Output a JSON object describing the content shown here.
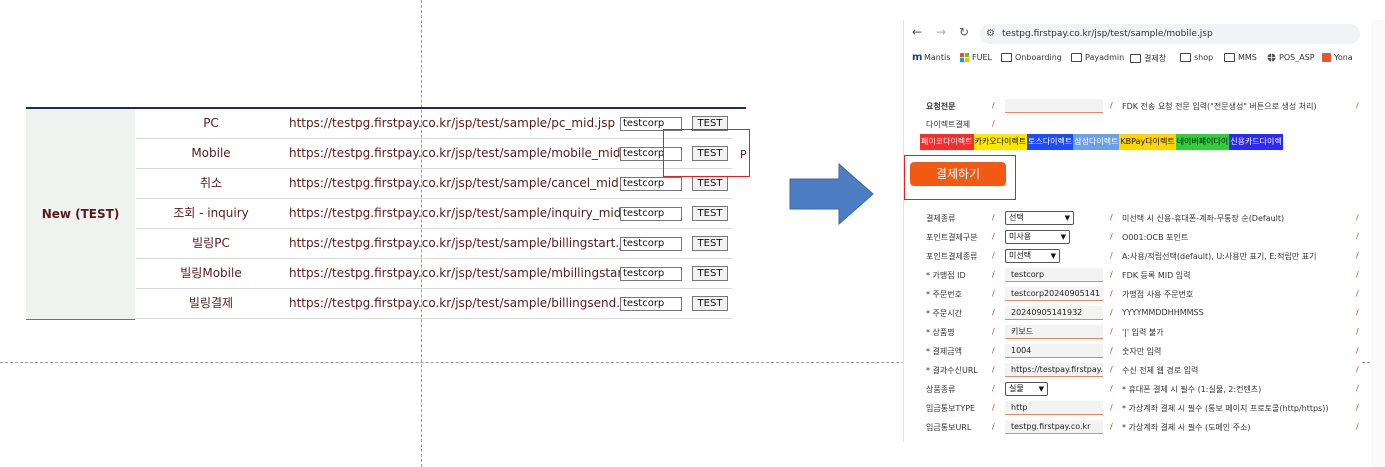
{
  "left_table": {
    "category": "New (TEST)",
    "rows": [
      {
        "name": "PC",
        "url": "https://testpg.firstpay.co.kr/jsp/test/sample/pc_mid.jsp",
        "input": "testcorp",
        "button": "TEST"
      },
      {
        "name": "Mobile",
        "url": "https://testpg.firstpay.co.kr/jsp/test/sample/mobile_mid.jsp",
        "input": "testcorp",
        "button": "TEST"
      },
      {
        "name": "취소",
        "url": "https://testpg.firstpay.co.kr/jsp/test/sample/cancel_mid.jsp",
        "input": "testcorp",
        "button": "TEST"
      },
      {
        "name": "조회 - inquiry",
        "url": "https://testpg.firstpay.co.kr/jsp/test/sample/inquiry_mid.jsp",
        "input": "testcorp",
        "button": "TEST"
      },
      {
        "name": "빌링PC",
        "url": "https://testpg.firstpay.co.kr/jsp/test/sample/billingstart.jsp",
        "input": "testcorp",
        "button": "TEST"
      },
      {
        "name": "빌링Mobile",
        "url": "https://testpg.firstpay.co.kr/jsp/test/sample/mbillingstart.jsp",
        "input": "testcorp",
        "button": "TEST"
      },
      {
        "name": "빌링결제",
        "url": "https://testpg.firstpay.co.kr/jsp/test/sample/billingsend.jsp",
        "input": "testcorp",
        "button": "TEST"
      }
    ],
    "trailing_char": "P"
  },
  "browser": {
    "url": "testpg.firstpay.co.kr/jsp/test/sample/mobile.jsp",
    "bookmarks": [
      {
        "label": "Mantis",
        "icon": "mantis-icon"
      },
      {
        "label": "FUEL",
        "icon": "windows-icon"
      },
      {
        "label": "Onboarding",
        "icon": "folder-icon"
      },
      {
        "label": "Payadmin",
        "icon": "folder-icon"
      },
      {
        "label": "결제창",
        "icon": "folder-icon"
      },
      {
        "label": "shop",
        "icon": "folder-icon"
      },
      {
        "label": "MMS",
        "icon": "folder-icon"
      },
      {
        "label": "POS_ASP",
        "icon": "globe-icon"
      },
      {
        "label": "Yona",
        "icon": "yona-icon"
      }
    ]
  },
  "form": {
    "request_label": "요청전문",
    "request_desc": "FDK 전송 요청 전문 입력(\"전문생성\" 버튼으로 생성 처리)",
    "direct_label": "다이렉트결제",
    "direct_buttons": [
      {
        "label": "페이코다이렉트",
        "color": "#ff2a2a"
      },
      {
        "label": "카카오다이렉트",
        "color": "#ffe600"
      },
      {
        "label": "토스다이렉트",
        "color": "#1e4bff"
      },
      {
        "label": "삼성다이렉트",
        "color": "#6aa0ea"
      },
      {
        "label": "KBPay다이렉트",
        "color": "#ffd400"
      },
      {
        "label": "네이버페이다이",
        "color": "#2fcf3a"
      },
      {
        "label": "신용카드다이렉",
        "color": "#2a2aff"
      }
    ],
    "pay_button": "결제하기",
    "fields": [
      {
        "label": "결제종류",
        "kind": "select",
        "value": "선택",
        "desc": "미선택 시 신용-휴대폰-계좌-무통장 순(Default)"
      },
      {
        "label": "포인트결제구분",
        "kind": "select",
        "value": "미사용",
        "desc": "O001:OCB 포인트"
      },
      {
        "label": "포인트결제종류",
        "kind": "select",
        "value": "미선택",
        "desc": "A:사용/적립선택(default), U:사용만 표기, E:적립만 표기"
      },
      {
        "label": "* 가맹점 ID",
        "kind": "input",
        "value": "testcorp",
        "desc": "FDK 등록 MID 입력"
      },
      {
        "label": "* 주문번호",
        "kind": "input",
        "value": "testcorp20240905141",
        "desc": "가맹점 사용 주문번호"
      },
      {
        "label": "* 주문시간",
        "kind": "input",
        "value": "20240905141932",
        "desc": "YYYYMMDDHHMMSS"
      },
      {
        "label": "* 상품명",
        "kind": "input",
        "value": "키보드",
        "desc": "'|' 입력 불가"
      },
      {
        "label": "* 결제금액",
        "kind": "input",
        "value": "1004",
        "desc": "숫자만 입력"
      },
      {
        "label": "* 결과수신URL",
        "kind": "input",
        "value": "https://testpay.firstpay.c",
        "desc": "수신 전체 웹 경로 입력"
      },
      {
        "label": "상품종류",
        "kind": "select",
        "value": "실물",
        "desc": "* 휴대폰 결제 시 필수 (1:실물, 2:컨텐츠)"
      },
      {
        "label": "입금통보TYPE",
        "kind": "input",
        "value": "http",
        "desc": "* 가상계좌 결제 시 필수 (통보 페이지 프로토콜(http/https))"
      },
      {
        "label": "입금통보URL",
        "kind": "input",
        "value": "testpg.firstpay.co.kr",
        "desc": "* 가상계좌 결제 시 필수 (도메인 주소)"
      }
    ]
  }
}
